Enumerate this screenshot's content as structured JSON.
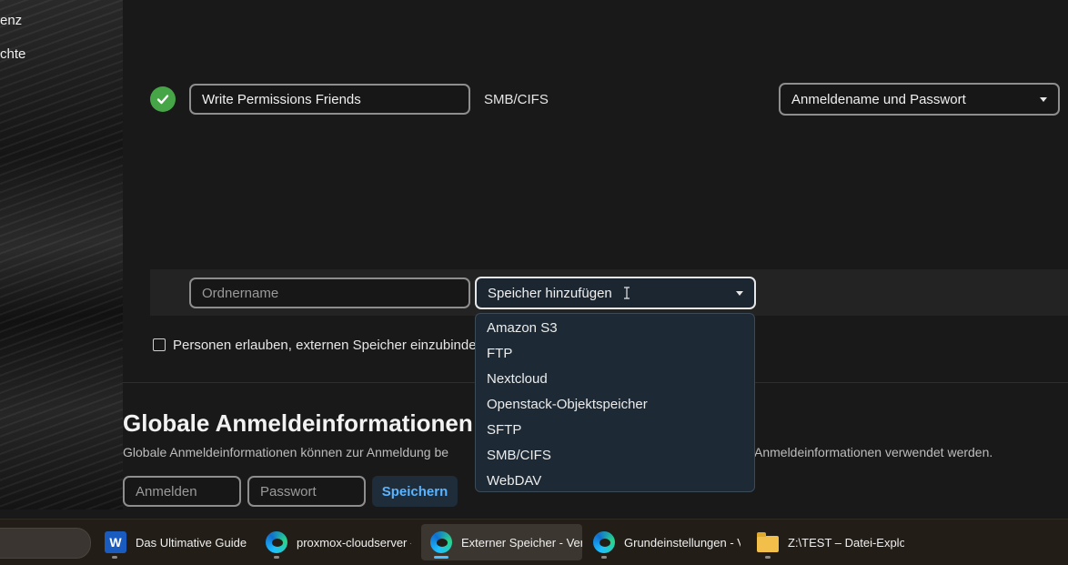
{
  "sidebar": {
    "items": [
      {
        "label": "enz"
      },
      {
        "label": "chte"
      }
    ]
  },
  "storage_row": {
    "folder_name": "Write Permissions Friends",
    "backend": "SMB/CIFS",
    "auth_method": "Anmeldename und Passwort",
    "status": "ok"
  },
  "add_row": {
    "folder_placeholder": "Ordnername",
    "add_storage_label": "Speicher hinzufügen",
    "options": [
      "Amazon S3",
      "FTP",
      "Nextcloud",
      "Openstack-Objektspeicher",
      "SFTP",
      "SMB/CIFS",
      "WebDAV"
    ]
  },
  "allow_users": {
    "label_visible": "Personen erlauben, externen Speicher einzubinden",
    "checked": false
  },
  "global_credentials": {
    "title": "Globale Anmeldeinformationen",
    "description_left": "Globale Anmeldeinformationen können zur Anmeldung be",
    "description_right": "Anmeldeinformationen verwendet werden.",
    "login_placeholder": "Anmelden",
    "password_placeholder": "Passwort",
    "save_label": "Speichern"
  },
  "taskbar": {
    "items": [
      {
        "label": "Das Ultimative Guide zu",
        "icon": "word-icon"
      },
      {
        "label": "proxmox-cloudserver -",
        "icon": "edge-icon"
      },
      {
        "label": "Externer Speicher - Verv",
        "icon": "edge-icon",
        "active": true
      },
      {
        "label": "Grundeinstellungen - Ve",
        "icon": "edge-icon"
      },
      {
        "label": "Z:\\TEST – Datei-Explorer",
        "icon": "folder-icon"
      }
    ]
  },
  "colors": {
    "success": "#46a546",
    "link_accent": "#5ab4ff",
    "dropdown_bg": "#1d2a35"
  }
}
